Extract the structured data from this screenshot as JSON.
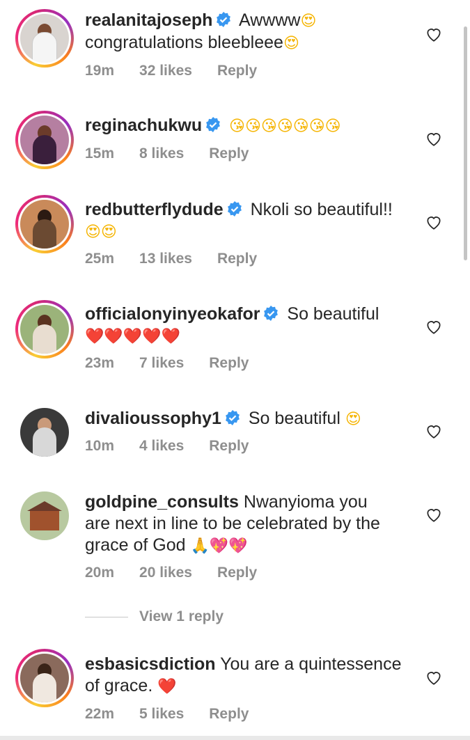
{
  "comments": [
    {
      "user": "realanitajoseph",
      "verified": true,
      "text": "Awwww",
      "emoji_after_text": "😍",
      "line2": "congratulations bleebleee",
      "line2_emoji": "😍",
      "time": "19m",
      "likes": "32 likes",
      "reply": "Reply",
      "ring": true,
      "avatar_color": "#d9d4d0"
    },
    {
      "user": "reginachukwu",
      "verified": true,
      "text": "",
      "emojis": "😘😘😘😘😘😘😘",
      "time": "15m",
      "likes": "8 likes",
      "reply": "Reply",
      "ring": true,
      "avatar_color": "#b57fa1"
    },
    {
      "user": "redbutterflydude",
      "verified": true,
      "text": "Nkoli so beautiful!!",
      "line2_emoji": "😍😍",
      "time": "25m",
      "likes": "13 likes",
      "reply": "Reply",
      "ring": true,
      "avatar_color": "#c98a5a"
    },
    {
      "user": "officialonyinyeokafor",
      "verified": true,
      "text": "So beautiful",
      "line2_emoji": "❤️❤️❤️❤️❤️",
      "time": "23m",
      "likes": "7 likes",
      "reply": "Reply",
      "ring": true,
      "avatar_color": "#9bb37a"
    },
    {
      "user": "divalioussophy1",
      "verified": true,
      "text": "So beautiful",
      "emoji_after_text": "😍",
      "time": "10m",
      "likes": "4 likes",
      "reply": "Reply",
      "ring": false,
      "avatar_color": "#3a3a3a"
    },
    {
      "user": "goldpine_consults",
      "verified": false,
      "text": "Nwanyioma you",
      "line2": "are next in line to be celebrated by the",
      "line3": "grace of God",
      "line3_emoji": "🙏💖💖",
      "time": "20m",
      "likes": "20 likes",
      "reply": "Reply",
      "ring": false,
      "avatar_color": "#b8c9a0"
    },
    {
      "user": "esbasicsdiction",
      "verified": false,
      "text": "You are a quintessence",
      "line2": "of grace.",
      "line2_emoji": "❤️",
      "time": "22m",
      "likes": "5 likes",
      "reply": "Reply",
      "ring": true,
      "avatar_color": "#8a6a5c"
    }
  ],
  "view_replies": "View 1 reply",
  "icons": {
    "verified": "verified-badge-icon",
    "like": "heart-outline-icon"
  },
  "colors": {
    "verified_blue": "#3897f0",
    "meta_gray": "#8e8e8e"
  }
}
